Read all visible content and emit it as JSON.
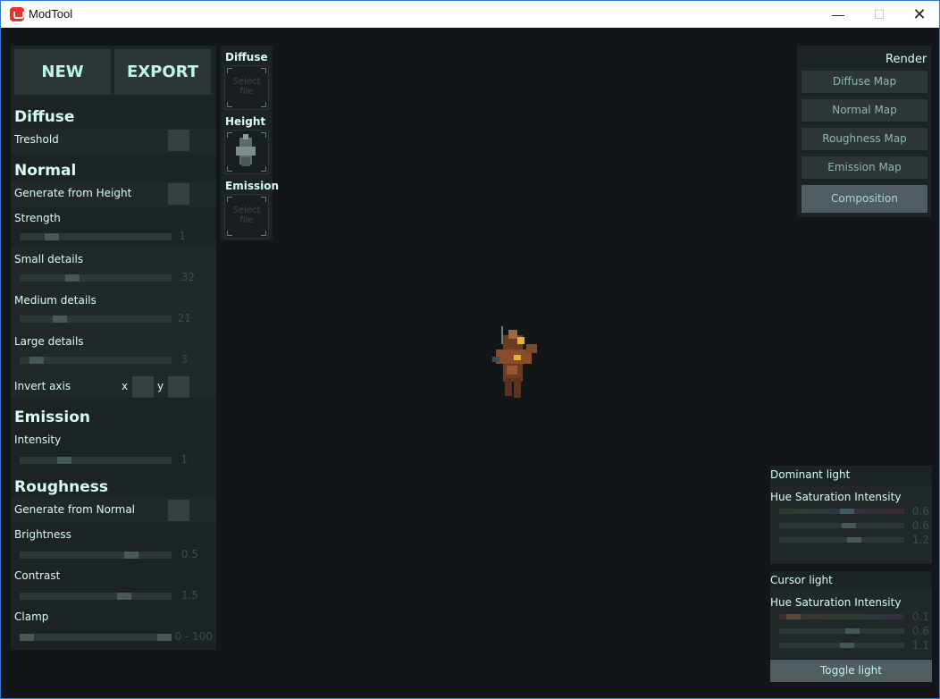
{
  "window": {
    "title": "ModTool",
    "minimize": "—",
    "maximize": "☐",
    "close": "✕"
  },
  "toolbar": {
    "new_label": "NEW",
    "export_label": "EXPORT"
  },
  "diffuse": {
    "header": "Diffuse",
    "treshold_label": "Treshold"
  },
  "normal": {
    "header": "Normal",
    "generate_label": "Generate from Height",
    "strength": {
      "label": "Strength",
      "value": "1",
      "level": 0.18
    },
    "small": {
      "label": "Small details",
      "value": "32",
      "level": 0.33
    },
    "medium": {
      "label": "Medium details",
      "value": "21",
      "level": 0.24
    },
    "large": {
      "label": "Large details",
      "value": "3",
      "level": 0.07
    },
    "invert_label": "Invert axis",
    "invert_x": "x",
    "invert_y": "y"
  },
  "emission": {
    "header": "Emission",
    "intensity": {
      "label": "Intensity",
      "value": "1",
      "level": 0.27
    }
  },
  "roughness": {
    "header": "Roughness",
    "generate_label": "Generate from Normal",
    "brightness": {
      "label": "Brightness",
      "value": "0.5",
      "level": 0.76
    },
    "contrast": {
      "label": "Contrast",
      "value": "1.5",
      "level": 0.71
    },
    "clamp": {
      "label": "Clamp",
      "value": "0 - 100",
      "low": 0.0,
      "high": 1.0
    }
  },
  "maps": {
    "diffuse": {
      "label": "Diffuse",
      "placeholder": "Select file"
    },
    "height": {
      "label": "Height"
    },
    "emission": {
      "label": "Emission",
      "placeholder": "Select file"
    }
  },
  "render": {
    "title": "Render",
    "buttons": [
      "Diffuse Map",
      "Normal Map",
      "Roughness Map",
      "Emission Map",
      "Composition"
    ],
    "active": "Composition"
  },
  "dominant_light": {
    "title": "Dominant light",
    "columns": "Hue Saturation Intensity",
    "hue": "0.6",
    "saturation": "0.6",
    "intensity": "1.2"
  },
  "cursor_light": {
    "title": "Cursor light",
    "columns": "Hue Saturation Intensity",
    "hue": "0.1",
    "saturation": "0.6",
    "intensity": "1.1"
  },
  "toggle_light_label": "Toggle light",
  "colors": {
    "background": "#121619",
    "panel": "#1c2326",
    "text": "#d8fbf5",
    "button": "#2c3638",
    "active_button": "#4f5d60"
  }
}
